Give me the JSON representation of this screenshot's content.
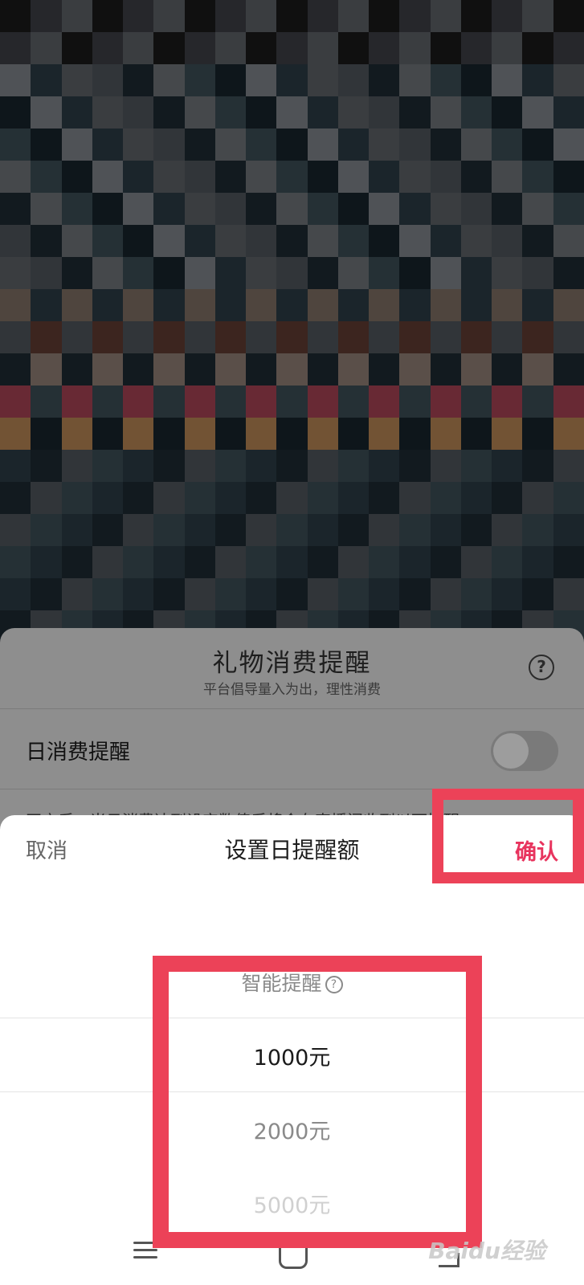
{
  "gift_panel": {
    "title": "礼物消费提醒",
    "subtitle": "平台倡导量入为出，理性消费",
    "daily_label": "日消费提醒",
    "daily_toggle_on": false,
    "daily_description": "开启后，当日消费达到设定数值后将会在直播间收到以下提醒"
  },
  "sheet": {
    "cancel_label": "取消",
    "title": "设置日提醒额",
    "confirm_label": "确认",
    "picker": {
      "smart_label": "智能提醒",
      "options": [
        "1000元",
        "2000元",
        "5000元"
      ],
      "selected": "1000元"
    }
  },
  "watermark": "Baidu经验",
  "colors": {
    "accent": "#e8345e",
    "highlight": "#ec4258"
  },
  "bg_palette": [
    "#1a1a1a",
    "#3b3d42",
    "#5a5e63",
    "#6a6f73",
    "#7a7f84",
    "#4c5258",
    "#3a4a52",
    "#2a3a42",
    "#1c2830",
    "#16222a",
    "#5c3a30",
    "#a04050",
    "#7a6a60",
    "#8a7a70",
    "#b08050",
    "#4a6a80",
    "#2e4048",
    "#20303a",
    "#6e7a80",
    "#9aa0a4"
  ]
}
